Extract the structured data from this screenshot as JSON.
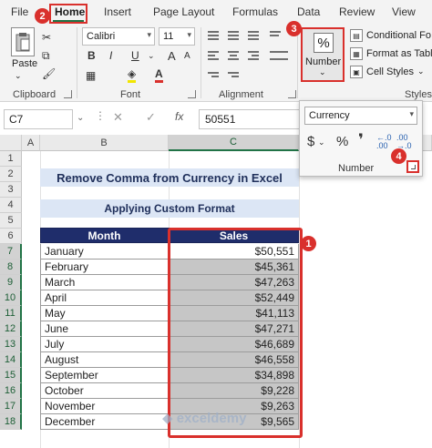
{
  "ribbon": {
    "tabs": [
      "File",
      "Home",
      "Insert",
      "Page Layout",
      "Formulas",
      "Data",
      "Review",
      "View"
    ],
    "active_tab": "Home",
    "clipboard": {
      "paste_label": "Paste",
      "group_label": "Clipboard"
    },
    "font": {
      "font_name": "Calibri",
      "font_size": "11",
      "group_label": "Font",
      "bold": "B",
      "italic": "I",
      "underline": "U",
      "grow": "A",
      "shrink": "A"
    },
    "alignment": {
      "group_label": "Alignment"
    },
    "number": {
      "symbol": "%",
      "label": "Number"
    },
    "styles": {
      "conditional": "Conditional Fo",
      "format_as_table": "Format as Table",
      "cell_styles": "Cell Styles",
      "group_label": "Styles"
    }
  },
  "formula_bar": {
    "name_box": "C7",
    "fx": "fx",
    "value": "50551"
  },
  "popup": {
    "format": "Currency",
    "currency_symbol": "$",
    "percent": "%",
    "comma": "❜",
    "inc_decimal": "←.0 .00",
    "dec_decimal": ".00 →.0",
    "label": "Number"
  },
  "markers": [
    "1",
    "2",
    "3",
    "4"
  ],
  "sheet": {
    "columns": [
      "A",
      "B",
      "C"
    ],
    "rows": [
      "1",
      "2",
      "3",
      "4",
      "5",
      "6",
      "7",
      "8",
      "9",
      "10",
      "11",
      "12",
      "13",
      "14",
      "15",
      "16",
      "17",
      "18"
    ],
    "title": "Remove Comma from Currency in Excel",
    "subtitle": "Applying Custom Format",
    "headers": [
      "Month",
      "Sales"
    ],
    "data": [
      [
        "January",
        "$50,551"
      ],
      [
        "February",
        "$45,361"
      ],
      [
        "March",
        "$47,263"
      ],
      [
        "April",
        "$52,449"
      ],
      [
        "May",
        "$41,113"
      ],
      [
        "June",
        "$47,271"
      ],
      [
        "July",
        "$46,689"
      ],
      [
        "August",
        "$46,558"
      ],
      [
        "September",
        "$34,898"
      ],
      [
        "October",
        "$9,228"
      ],
      [
        "November",
        "$9,263"
      ],
      [
        "December",
        "$9,565"
      ]
    ]
  },
  "watermark": "exceldemy"
}
